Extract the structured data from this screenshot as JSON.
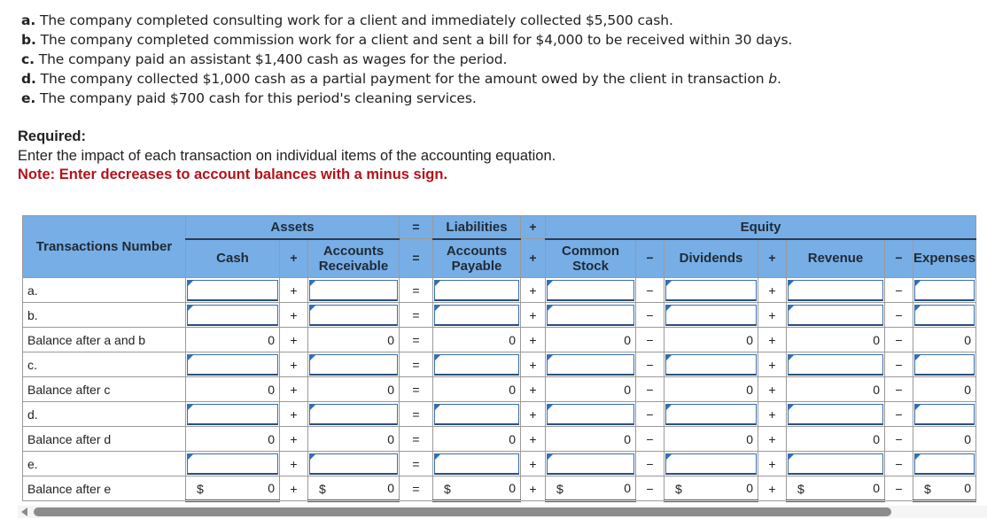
{
  "transactions": [
    {
      "letter": "a.",
      "text": " The company completed consulting work for a client and immediately collected $5,500 cash."
    },
    {
      "letter": "b.",
      "text": " The company completed commission work for a client and sent a bill for $4,000 to be received within 30 days."
    },
    {
      "letter": "c.",
      "text": " The company paid an assistant $1,400 cash as wages for the period."
    },
    {
      "letter": "d.",
      "text": " The company collected $1,000 cash as a partial payment for the amount owed by the client in transaction ",
      "emph": "b",
      "tail": "."
    },
    {
      "letter": "e.",
      "text": " The company paid $700 cash for this period's cleaning services."
    }
  ],
  "required": {
    "heading": "Required:",
    "instruction": "Enter the impact of each transaction on individual items of the accounting equation.",
    "note": "Note: Enter decreases to account balances with a minus sign."
  },
  "table": {
    "header_groups": {
      "transactions": "Transactions Number",
      "assets": "Assets",
      "eq": "=",
      "liabilities": "Liabilities",
      "plus": "+",
      "equity": "Equity"
    },
    "columns": {
      "cash": "Cash",
      "op1": "+",
      "ar_1": "Accounts",
      "ar_2": "Receivable",
      "op2": "=",
      "ap_1": "Accounts",
      "ap_2": "Payable",
      "op3": "+",
      "cs_1": "Common",
      "cs_2": "Stock",
      "op4": "−",
      "div": "Dividends",
      "op5": "+",
      "rev": "Revenue",
      "op6": "−",
      "exp": "Expenses"
    },
    "ops": [
      "+",
      "=",
      "+",
      "−",
      "+",
      "−"
    ],
    "rows": [
      {
        "label": "a.",
        "type": "input"
      },
      {
        "label": "b.",
        "type": "input"
      },
      {
        "label": "Balance after a and b",
        "type": "balance",
        "values": [
          "0",
          "0",
          "0",
          "0",
          "0",
          "0",
          "0"
        ]
      },
      {
        "label": "c.",
        "type": "input"
      },
      {
        "label": "Balance after c",
        "type": "balance",
        "values": [
          "0",
          "0",
          "0",
          "0",
          "0",
          "0",
          "0"
        ]
      },
      {
        "label": "d.",
        "type": "input"
      },
      {
        "label": "Balance after d",
        "type": "balance",
        "values": [
          "0",
          "0",
          "0",
          "0",
          "0",
          "0",
          "0"
        ]
      },
      {
        "label": "e.",
        "type": "input"
      },
      {
        "label": "Balance after e",
        "type": "total",
        "currency": "$",
        "values": [
          "0",
          "0",
          "0",
          "0",
          "0",
          "0",
          "0"
        ]
      }
    ]
  }
}
